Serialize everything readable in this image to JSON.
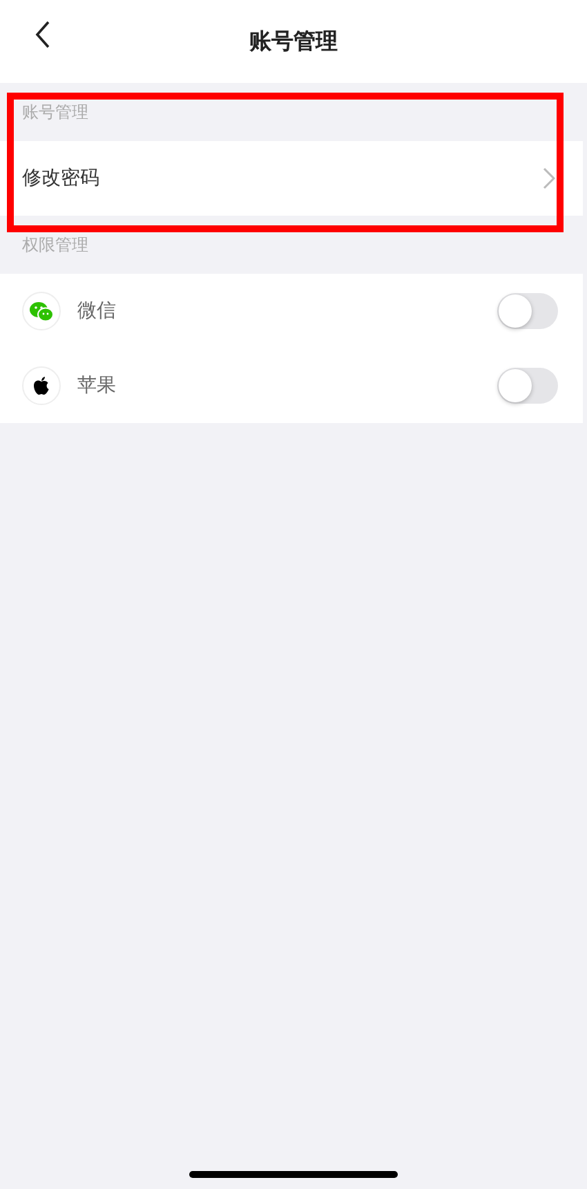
{
  "header": {
    "title": "账号管理"
  },
  "sections": [
    {
      "title": "账号管理",
      "rows": [
        {
          "kind": "link",
          "label": "修改密码"
        }
      ]
    },
    {
      "title": "权限管理",
      "rows": [
        {
          "kind": "toggle",
          "label": "微信",
          "on": false
        },
        {
          "kind": "toggle",
          "label": "苹果",
          "on": false
        }
      ]
    }
  ],
  "highlight": true
}
